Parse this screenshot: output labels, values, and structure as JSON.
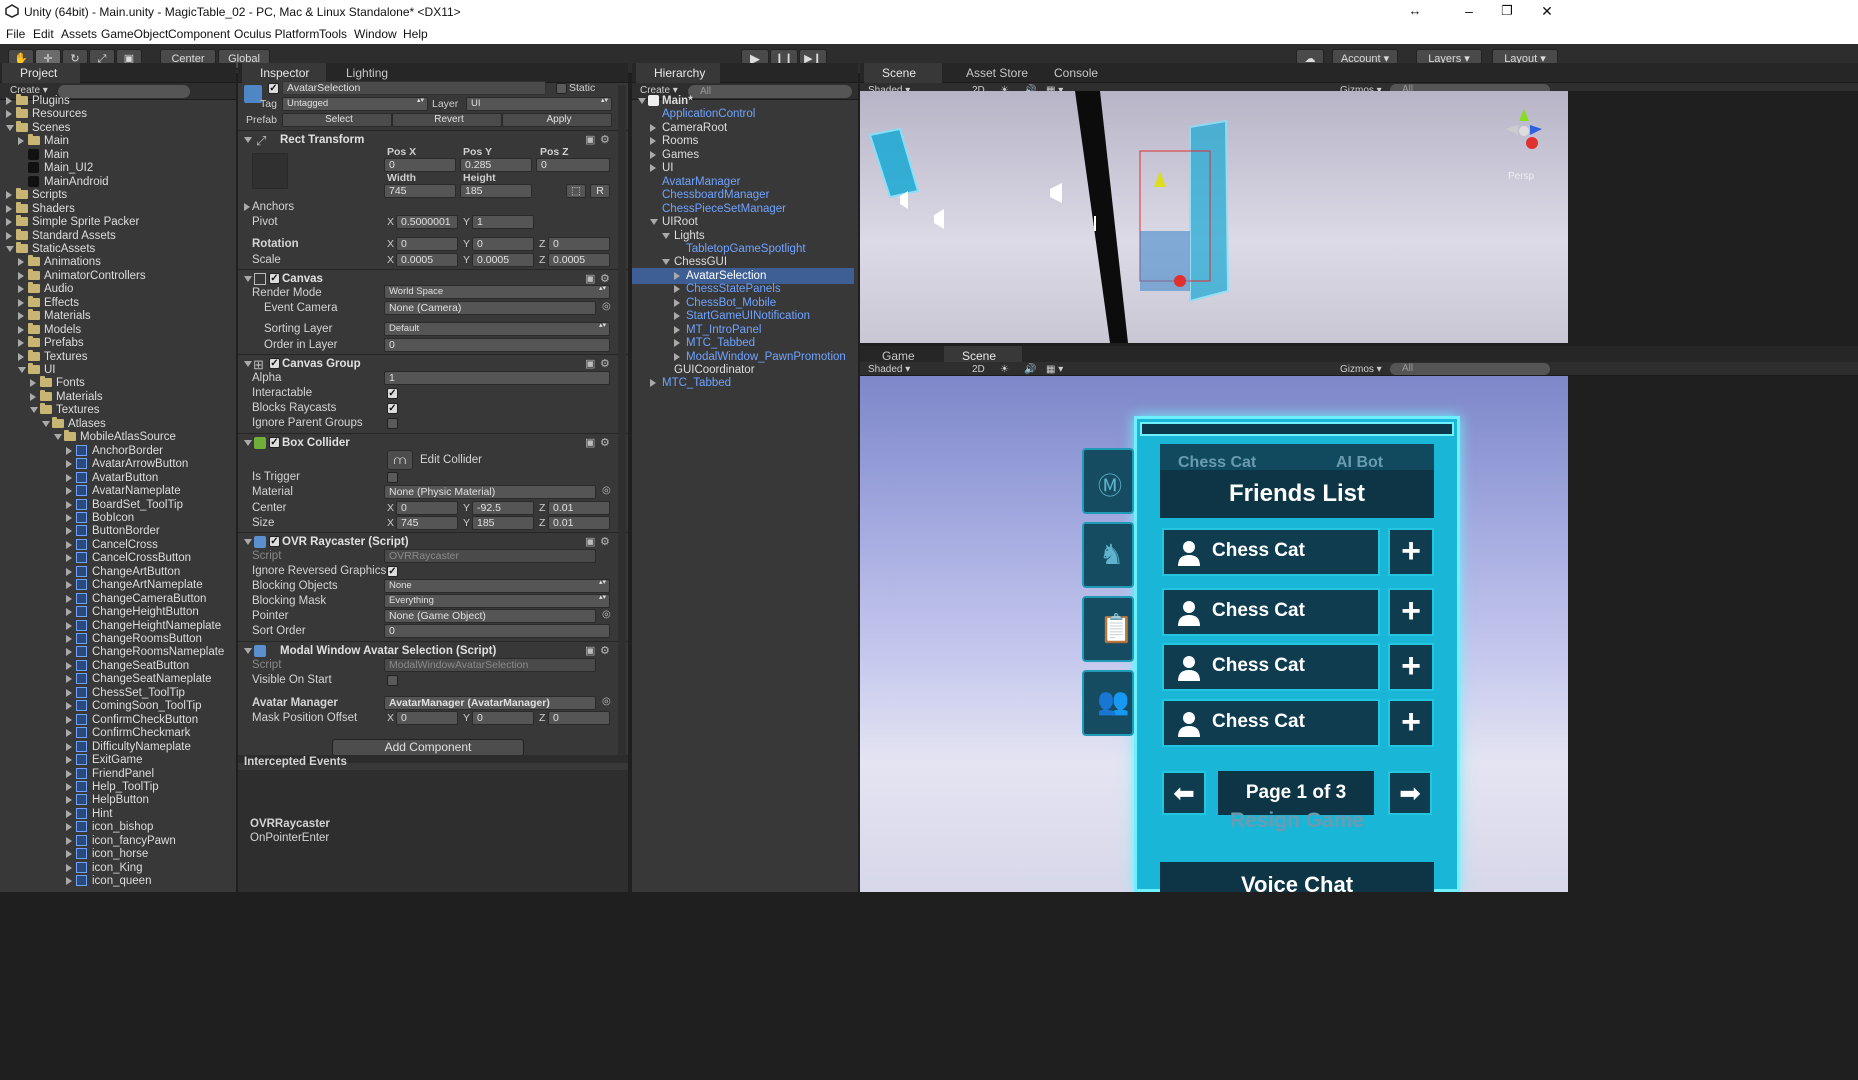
{
  "window": {
    "title": "Unity (64bit) - Main.unity - MagicTable_02 - PC, Mac & Linux Standalone* <DX11>"
  },
  "menu": [
    "File",
    "Edit",
    "Assets",
    "GameObject",
    "Component",
    "Oculus Platform",
    "Tools",
    "Window",
    "Help"
  ],
  "toolbar": {
    "center": "Center",
    "global": "Global",
    "account": "Account",
    "layers": "Layers",
    "layout": "Layout"
  },
  "project": {
    "tab": "Project",
    "create": "Create",
    "items": [
      {
        "label": "Plugins",
        "depth": 0,
        "type": "folder",
        "open": false
      },
      {
        "label": "Resources",
        "depth": 0,
        "type": "folder",
        "open": false
      },
      {
        "label": "Scenes",
        "depth": 0,
        "type": "folder",
        "open": true
      },
      {
        "label": "Main",
        "depth": 1,
        "type": "folder",
        "open": false
      },
      {
        "label": "Main",
        "depth": 1,
        "type": "unity"
      },
      {
        "label": "Main_UI2",
        "depth": 1,
        "type": "unity"
      },
      {
        "label": "MainAndroid",
        "depth": 1,
        "type": "unity"
      },
      {
        "label": "Scripts",
        "depth": 0,
        "type": "folder",
        "open": false
      },
      {
        "label": "Shaders",
        "depth": 0,
        "type": "folder",
        "open": false
      },
      {
        "label": "Simple Sprite Packer",
        "depth": 0,
        "type": "folder",
        "open": false
      },
      {
        "label": "Standard Assets",
        "depth": 0,
        "type": "folder",
        "open": false
      },
      {
        "label": "StaticAssets",
        "depth": 0,
        "type": "folder",
        "open": true
      },
      {
        "label": "Animations",
        "depth": 1,
        "type": "folder",
        "open": false
      },
      {
        "label": "AnimatorControllers",
        "depth": 1,
        "type": "folder",
        "open": false
      },
      {
        "label": "Audio",
        "depth": 1,
        "type": "folder",
        "open": false
      },
      {
        "label": "Effects",
        "depth": 1,
        "type": "folder",
        "open": false
      },
      {
        "label": "Materials",
        "depth": 1,
        "type": "folder",
        "open": false
      },
      {
        "label": "Models",
        "depth": 1,
        "type": "folder",
        "open": false
      },
      {
        "label": "Prefabs",
        "depth": 1,
        "type": "folder",
        "open": false
      },
      {
        "label": "Textures",
        "depth": 1,
        "type": "folder",
        "open": false
      },
      {
        "label": "UI",
        "depth": 1,
        "type": "folder",
        "open": true
      },
      {
        "label": "Fonts",
        "depth": 2,
        "type": "folder",
        "open": false
      },
      {
        "label": "Materials",
        "depth": 2,
        "type": "folder",
        "open": false
      },
      {
        "label": "Textures",
        "depth": 2,
        "type": "folder",
        "open": true
      },
      {
        "label": "Atlases",
        "depth": 3,
        "type": "folder",
        "open": true
      },
      {
        "label": "MobileAtlasSource",
        "depth": 4,
        "type": "folder",
        "open": true
      },
      {
        "label": "AnchorBorder",
        "depth": 5,
        "type": "sprite"
      },
      {
        "label": "AvatarArrowButton",
        "depth": 5,
        "type": "sprite"
      },
      {
        "label": "AvatarButton",
        "depth": 5,
        "type": "sprite"
      },
      {
        "label": "AvatarNameplate",
        "depth": 5,
        "type": "sprite"
      },
      {
        "label": "BoardSet_ToolTip",
        "depth": 5,
        "type": "sprite"
      },
      {
        "label": "BobIcon",
        "depth": 5,
        "type": "sprite"
      },
      {
        "label": "ButtonBorder",
        "depth": 5,
        "type": "sprite"
      },
      {
        "label": "CancelCross",
        "depth": 5,
        "type": "sprite"
      },
      {
        "label": "CancelCrossButton",
        "depth": 5,
        "type": "sprite"
      },
      {
        "label": "ChangeArtButton",
        "depth": 5,
        "type": "sprite"
      },
      {
        "label": "ChangeArtNameplate",
        "depth": 5,
        "type": "sprite"
      },
      {
        "label": "ChangeCameraButton",
        "depth": 5,
        "type": "sprite"
      },
      {
        "label": "ChangeHeightButton",
        "depth": 5,
        "type": "sprite"
      },
      {
        "label": "ChangeHeightNameplate",
        "depth": 5,
        "type": "sprite"
      },
      {
        "label": "ChangeRoomsButton",
        "depth": 5,
        "type": "sprite"
      },
      {
        "label": "ChangeRoomsNameplate",
        "depth": 5,
        "type": "sprite"
      },
      {
        "label": "ChangeSeatButton",
        "depth": 5,
        "type": "sprite"
      },
      {
        "label": "ChangeSeatNameplate",
        "depth": 5,
        "type": "sprite"
      },
      {
        "label": "ChessSet_ToolTip",
        "depth": 5,
        "type": "sprite"
      },
      {
        "label": "ComingSoon_ToolTip",
        "depth": 5,
        "type": "sprite"
      },
      {
        "label": "ConfirmCheckButton",
        "depth": 5,
        "type": "sprite"
      },
      {
        "label": "ConfirmCheckmark",
        "depth": 5,
        "type": "sprite"
      },
      {
        "label": "DifficultyNameplate",
        "depth": 5,
        "type": "sprite"
      },
      {
        "label": "ExitGame",
        "depth": 5,
        "type": "sprite"
      },
      {
        "label": "FriendPanel",
        "depth": 5,
        "type": "sprite"
      },
      {
        "label": "Help_ToolTip",
        "depth": 5,
        "type": "sprite"
      },
      {
        "label": "HelpButton",
        "depth": 5,
        "type": "sprite"
      },
      {
        "label": "Hint",
        "depth": 5,
        "type": "sprite"
      },
      {
        "label": "icon_bishop",
        "depth": 5,
        "type": "sprite"
      },
      {
        "label": "icon_fancyPawn",
        "depth": 5,
        "type": "sprite"
      },
      {
        "label": "icon_horse",
        "depth": 5,
        "type": "sprite"
      },
      {
        "label": "icon_King",
        "depth": 5,
        "type": "sprite"
      },
      {
        "label": "icon_queen",
        "depth": 5,
        "type": "sprite"
      }
    ]
  },
  "inspector": {
    "tabs": [
      "Inspector",
      "Lighting"
    ],
    "object_name": "AvatarSelection",
    "static_label": "Static",
    "tag_label": "Tag",
    "tag_value": "Untagged",
    "layer_label": "Layer",
    "layer_value": "UI",
    "prefab_label": "Prefab",
    "prefab_buttons": [
      "Select",
      "Revert",
      "Apply"
    ],
    "rect": {
      "title": "Rect Transform",
      "posx_label": "Pos X",
      "posy_label": "Pos Y",
      "posz_label": "Pos Z",
      "posx": "0",
      "posy": "0.285",
      "posz": "0",
      "width_label": "Width",
      "height_label": "Height",
      "width": "745",
      "height": "185",
      "r_btn": "R",
      "anchors": "Anchors",
      "pivot": "Pivot",
      "pivot_x": "0.5000001",
      "pivot_y": "1",
      "rotation": "Rotation",
      "rot_x": "0",
      "rot_y": "0",
      "rot_z": "0",
      "scale": "Scale",
      "scale_x": "0.0005",
      "scale_y": "0.0005",
      "scale_z": "0.0005"
    },
    "canvas": {
      "title": "Canvas",
      "render_mode_label": "Render Mode",
      "render_mode": "World Space",
      "event_camera_label": "Event Camera",
      "event_camera": "None (Camera)",
      "sorting_layer_label": "Sorting Layer",
      "sorting_layer": "Default",
      "order_label": "Order in Layer",
      "order": "0"
    },
    "canvas_group": {
      "title": "Canvas Group",
      "alpha_label": "Alpha",
      "alpha": "1",
      "interactable": "Interactable",
      "blocks": "Blocks Raycasts",
      "ignore": "Ignore Parent Groups"
    },
    "box_collider": {
      "title": "Box Collider",
      "edit": "Edit Collider",
      "trigger": "Is Trigger",
      "material_label": "Material",
      "material": "None (Physic Material)",
      "center_label": "Center",
      "cx": "0",
      "cy": "-92.5",
      "cz": "0.01",
      "size_label": "Size",
      "sx": "745",
      "sy": "185",
      "sz": "0.01"
    },
    "ovr": {
      "title": "OVR Raycaster (Script)",
      "script_label": "Script",
      "script": "OVRRaycaster",
      "ignore_rev": "Ignore Reversed Graphics",
      "blocking_objects_label": "Blocking Objects",
      "blocking_objects": "None",
      "blocking_mask_label": "Blocking Mask",
      "blocking_mask": "Everything",
      "pointer_label": "Pointer",
      "pointer": "None (Game Object)",
      "sort_label": "Sort Order",
      "sort": "0"
    },
    "modal": {
      "title": "Modal Window Avatar Selection (Script)",
      "script_label": "Script",
      "script": "ModalWindowAvatarSelection",
      "visible": "Visible On Start",
      "manager_label": "Avatar Manager",
      "manager": "AvatarManager (AvatarManager)",
      "mask_label": "Mask Position Offset",
      "mx": "0",
      "my": "0",
      "mz": "0"
    },
    "add_component": "Add Component",
    "intercepted": "Intercepted Events",
    "event_src": "OVRRaycaster",
    "event_name": "OnPointerEnter"
  },
  "hierarchy": {
    "tab": "Hierarchy",
    "create": "Create",
    "search": "All",
    "items": [
      {
        "label": "Main*",
        "depth": 0,
        "kind": "scene",
        "open": true
      },
      {
        "label": "ApplicationControl",
        "depth": 1,
        "kind": "prefab"
      },
      {
        "label": "CameraRoot",
        "depth": 1,
        "kind": "obj",
        "arrow": "r"
      },
      {
        "label": "Rooms",
        "depth": 1,
        "kind": "obj",
        "arrow": "r"
      },
      {
        "label": "Games",
        "depth": 1,
        "kind": "obj",
        "arrow": "r"
      },
      {
        "label": "UI",
        "depth": 1,
        "kind": "obj",
        "arrow": "r"
      },
      {
        "label": "AvatarManager",
        "depth": 1,
        "kind": "prefab"
      },
      {
        "label": "ChessboardManager",
        "depth": 1,
        "kind": "prefab"
      },
      {
        "label": "ChessPieceSetManager",
        "depth": 1,
        "kind": "prefab"
      },
      {
        "label": "UIRoot",
        "depth": 1,
        "kind": "obj",
        "arrow": "d"
      },
      {
        "label": "Lights",
        "depth": 2,
        "kind": "obj",
        "arrow": "d"
      },
      {
        "label": "TabletopGameSpotlight",
        "depth": 3,
        "kind": "prefab"
      },
      {
        "label": "ChessGUI",
        "depth": 2,
        "kind": "obj",
        "arrow": "d"
      },
      {
        "label": "AvatarSelection",
        "depth": 3,
        "kind": "prefab",
        "arrow": "r",
        "selected": true
      },
      {
        "label": "ChessStatePanels",
        "depth": 3,
        "kind": "prefab",
        "arrow": "r"
      },
      {
        "label": "ChessBot_Mobile",
        "depth": 3,
        "kind": "prefab",
        "arrow": "r"
      },
      {
        "label": "StartGameUINotification",
        "depth": 3,
        "kind": "prefab",
        "arrow": "r"
      },
      {
        "label": "MT_IntroPanel",
        "depth": 3,
        "kind": "prefab",
        "arrow": "r"
      },
      {
        "label": "MTC_Tabbed",
        "depth": 3,
        "kind": "prefab",
        "arrow": "r"
      },
      {
        "label": "ModalWindow_PawnPromotion",
        "depth": 3,
        "kind": "prefab",
        "arrow": "r"
      },
      {
        "label": "GUICoordinator",
        "depth": 2,
        "kind": "obj"
      },
      {
        "label": "MTC_Tabbed",
        "depth": 1,
        "kind": "prefab",
        "arrow": "r"
      }
    ]
  },
  "scene": {
    "tabs": [
      "Scene",
      "Asset Store",
      "Console"
    ],
    "shaded": "Shaded",
    "mode2d": "2D",
    "gizmos": "Gizmos",
    "search": "All",
    "persp": "Persp"
  },
  "game": {
    "tabs": [
      "Game",
      "Scene"
    ],
    "shaded": "Shaded",
    "mode2d": "2D",
    "gizmos": "Gizmos",
    "search": "All",
    "tab_chess_cat": "Chess Cat",
    "tab_ai_bot": "AI Bot",
    "friends_title": "Friends List",
    "friends": [
      "Chess Cat",
      "Chess Cat",
      "Chess Cat",
      "Chess Cat"
    ],
    "page": "Page 1 of 3",
    "resign": "Resign Game",
    "voice": "Voice Chat"
  },
  "colors": {
    "accent": "#23c6e0",
    "selection": "#3e5f96",
    "prefab_text": "#6fa3ff",
    "panel": "#383838"
  }
}
